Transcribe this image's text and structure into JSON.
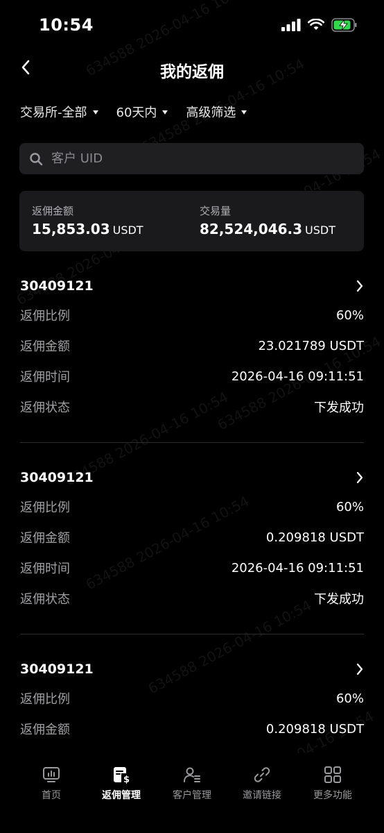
{
  "status_bar": {
    "time": "10:54"
  },
  "header": {
    "title": "我的返佣"
  },
  "filters": [
    {
      "label": "交易所-全部"
    },
    {
      "label": "60天内"
    },
    {
      "label": "高级筛选"
    }
  ],
  "search": {
    "placeholder": "客户 UID"
  },
  "summary": {
    "rebate_amount_label": "返佣金额",
    "rebate_amount_value": "15,853.03",
    "rebate_amount_unit": "USDT",
    "volume_label": "交易量",
    "volume_value": "82,524,046.3",
    "volume_unit": "USDT"
  },
  "field_labels": {
    "ratio": "返佣比例",
    "amount": "返佣金额",
    "time": "返佣时间",
    "status": "返佣状态"
  },
  "records": [
    {
      "uid": "30409121",
      "ratio": "60%",
      "amount": "23.021789 USDT",
      "time": "2026-04-16 09:11:51",
      "status": "下发成功"
    },
    {
      "uid": "30409121",
      "ratio": "60%",
      "amount": "0.209818 USDT",
      "time": "2026-04-16 09:11:51",
      "status": "下发成功"
    },
    {
      "uid": "30409121",
      "ratio": "60%",
      "amount": "0.209818 USDT"
    }
  ],
  "tabs": [
    {
      "label": "首页",
      "icon": "monitor-chart-icon"
    },
    {
      "label": "返佣管理",
      "icon": "rebate-document-icon",
      "active": true
    },
    {
      "label": "客户管理",
      "icon": "user-list-icon"
    },
    {
      "label": "邀请链接",
      "icon": "link-icon"
    },
    {
      "label": "更多功能",
      "icon": "grid-icon"
    }
  ],
  "watermark": {
    "text": "634588 2026-04-16 10:54"
  }
}
